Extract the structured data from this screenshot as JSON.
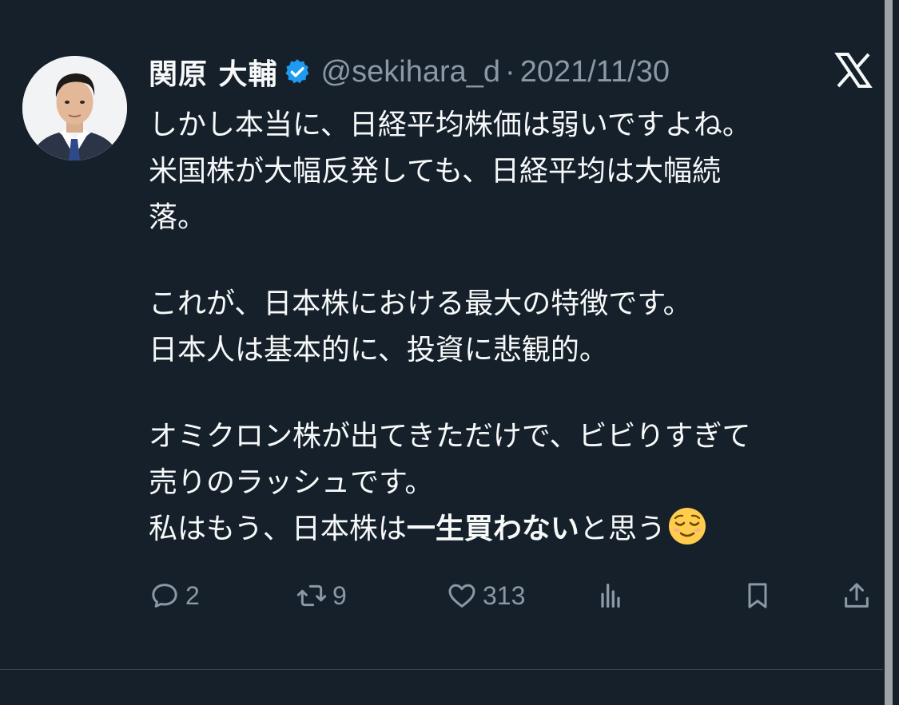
{
  "author": {
    "name": "関原 大輔",
    "handle": "@sekihara_d",
    "separator": "·",
    "date": "2021/11/30",
    "verified": true
  },
  "tweet": {
    "line1": "しかし本当に、日経平均株価は弱いですよね。",
    "line2": "米国株が大幅反発しても、日経平均は大幅続",
    "line3": "落。",
    "line4": "これが、日本株における最大の特徴です。",
    "line5": "日本人は基本的に、投資に悲観的。",
    "line6": "オミクロン株が出てきただけで、ビビりすぎて",
    "line7": "売りのラッシュです。",
    "line8_prefix": "私はもう、日本株は",
    "line8_bold": "一生買わない",
    "line8_suffix": "と思う",
    "emoji": "relieved-face"
  },
  "actions": {
    "replies": "2",
    "retweets": "9",
    "likes": "313"
  },
  "icons": {
    "platform_logo": "x-logo-icon",
    "verified": "verified-badge-icon",
    "reply": "reply-icon",
    "retweet": "retweet-icon",
    "like": "heart-icon",
    "views": "views-icon",
    "bookmark": "bookmark-icon",
    "share": "share-icon"
  },
  "colors": {
    "background": "#15202b",
    "text": "#f7f9f9",
    "secondary_text": "#8b98a5",
    "verified_blue": "#1d9bf0"
  }
}
